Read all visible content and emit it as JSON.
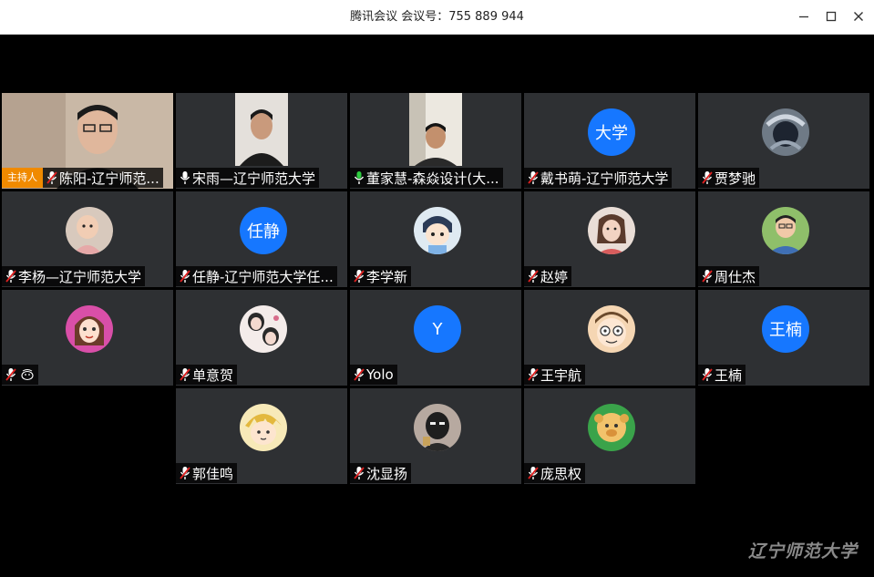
{
  "window": {
    "title": "腾讯会议 会议号：755 889 944",
    "minimize_icon": "minimize-icon",
    "maximize_icon": "maximize-icon",
    "close_icon": "close-icon"
  },
  "host_badge": "主持人",
  "participants": [
    {
      "name": "陈阳-辽宁师范...",
      "mic": "muted",
      "avatar_type": "video"
    },
    {
      "name": "宋雨—辽宁师范大学",
      "mic": "on",
      "avatar_type": "video"
    },
    {
      "name": "董家慧-森焱设计(大...",
      "mic": "speaking",
      "avatar_type": "video"
    },
    {
      "name": "戴书萌-辽宁师范大学",
      "mic": "muted",
      "avatar_text": "大学"
    },
    {
      "name": "贾梦驰",
      "mic": "muted",
      "avatar_type": "image"
    },
    {
      "name": "李杨—辽宁师范大学",
      "mic": "muted",
      "avatar_type": "image"
    },
    {
      "name": "任静-辽宁师范大学任...",
      "mic": "muted",
      "avatar_text": "任静"
    },
    {
      "name": "李学新",
      "mic": "muted",
      "avatar_type": "image"
    },
    {
      "name": "赵婷",
      "mic": "muted",
      "avatar_type": "image"
    },
    {
      "name": "周仕杰",
      "mic": "muted",
      "avatar_type": "image"
    },
    {
      "name": "",
      "mic": "muted",
      "avatar_type": "image",
      "name_icon": "face-emoji-icon"
    },
    {
      "name": "单意贺",
      "mic": "muted",
      "avatar_type": "image"
    },
    {
      "name": "Yolo",
      "mic": "muted",
      "avatar_text": "Y"
    },
    {
      "name": "王宇航",
      "mic": "muted",
      "avatar_type": "image"
    },
    {
      "name": "王楠",
      "mic": "muted",
      "avatar_text": "王楠"
    },
    {
      "name": "郭佳鸣",
      "mic": "muted",
      "avatar_type": "image"
    },
    {
      "name": "沈显扬",
      "mic": "muted",
      "avatar_type": "image"
    },
    {
      "name": "庞思权",
      "mic": "muted",
      "avatar_type": "image"
    }
  ],
  "watermark": "辽宁师范大学",
  "colors": {
    "tile_bg": "#2e3033",
    "avatar_blue": "#1677ff",
    "host_badge": "#f08a00",
    "mic_muted": "#e02020",
    "mic_speaking": "#2ecc40"
  }
}
